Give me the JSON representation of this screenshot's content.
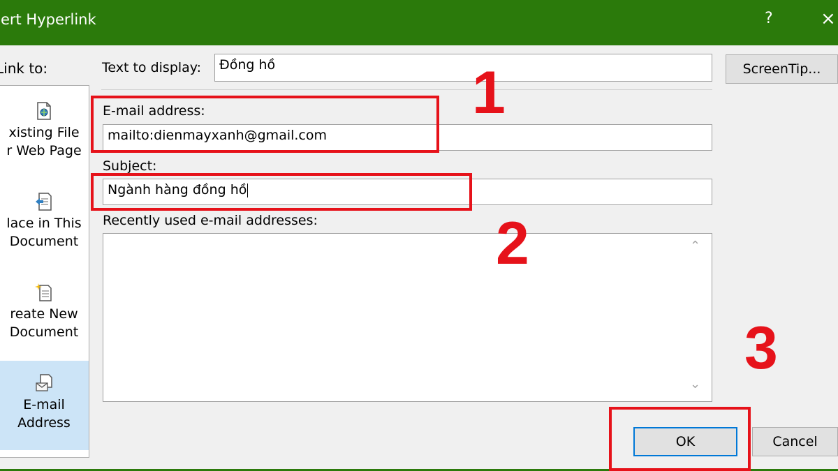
{
  "window": {
    "title": "sert Hyperlink",
    "help_glyph": "?",
    "close_glyph": "×"
  },
  "sidebar": {
    "label": "Link to:",
    "items": [
      {
        "line1": "xisting File",
        "line2": "r Web Page",
        "icon": "existing-file-icon",
        "selected": false
      },
      {
        "line1": "lace in This",
        "line2": "Document",
        "icon": "place-in-document-icon",
        "selected": false
      },
      {
        "line1": "reate New",
        "line2": "Document",
        "icon": "create-new-document-icon",
        "selected": false
      },
      {
        "line1": "E-mail",
        "line2": "Address",
        "icon": "email-address-icon",
        "selected": true
      }
    ]
  },
  "form": {
    "text_to_display_label": "Text to display:",
    "text_to_display_value": "Đồng hồ",
    "screentip_label": "ScreenTip...",
    "email_label": "E-mail address:",
    "email_value": "mailto:dienmayxanh@gmail.com",
    "subject_label": "Subject:",
    "subject_value": "Ngành hàng đồng hồ",
    "recent_label": "Recently used e-mail addresses:"
  },
  "buttons": {
    "ok": "OK",
    "cancel": "Cancel"
  },
  "annotations": {
    "step1": "1",
    "step2": "2",
    "step3": "3",
    "color": "#e6121a"
  },
  "colors": {
    "titlebar": "#2b7a0b",
    "selection": "#cce4f7",
    "default_button_border": "#0078d7"
  }
}
